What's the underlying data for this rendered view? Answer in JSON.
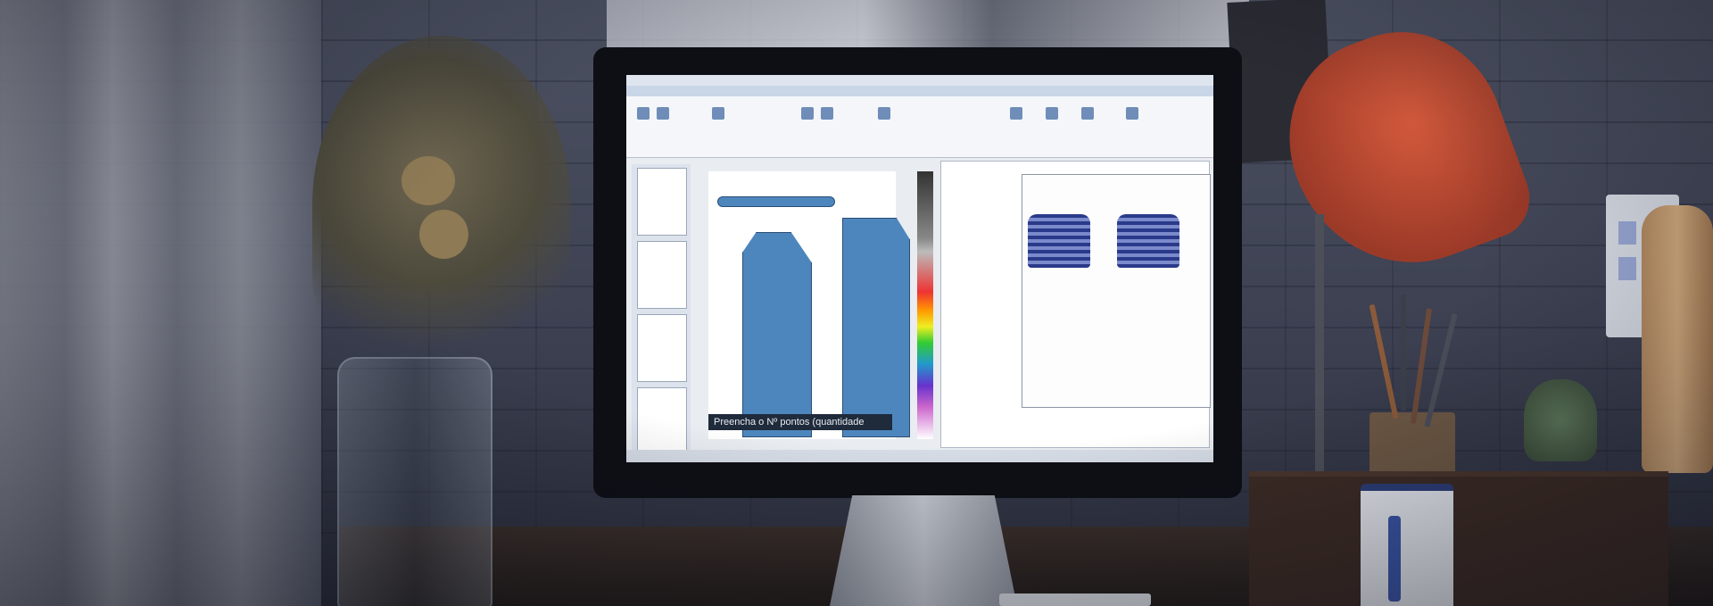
{
  "scene": {
    "description_label": "",
    "screen": {
      "status_text": "Preencha o Nº pontos (quantidade"
    }
  },
  "palette": {
    "wall": "#4d5263",
    "monitor_bezel": "#0d0f15",
    "lamp_shade": "#d45a3c",
    "pattern_blue": "#4d86bd",
    "mug_blue": "#3a56a8"
  }
}
